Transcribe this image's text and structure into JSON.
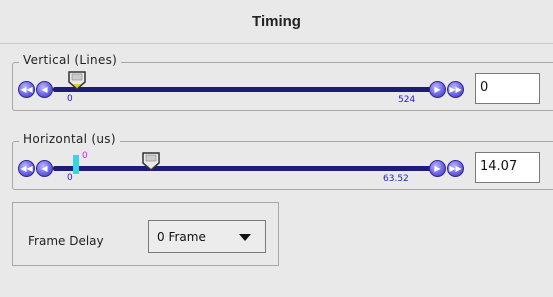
{
  "panel": {
    "title": "Timing"
  },
  "vertical": {
    "group_label": "Vertical (Lines)",
    "min_label": "0",
    "max_label": "524",
    "value": "0",
    "position": 0,
    "icons": [
      "skip-back-icon",
      "step-back-icon",
      "step-forward-icon",
      "skip-forward-icon"
    ]
  },
  "horizontal": {
    "group_label": "Horizontal (us)",
    "min_label": "0",
    "max_label": "63.52",
    "marker_label": "0",
    "value": "14.07",
    "position": 0.22,
    "icons": [
      "skip-back-icon",
      "step-back-icon",
      "step-forward-icon",
      "skip-forward-icon"
    ]
  },
  "frame_delay": {
    "label": "Frame Delay",
    "selected": "0 Frame"
  },
  "colors": {
    "track": "#1f1c78",
    "button": "#6f66e6",
    "tick_label": "#2222cc",
    "cyan_marker": "#35d5ec",
    "magenta_label": "#e01ee0"
  }
}
